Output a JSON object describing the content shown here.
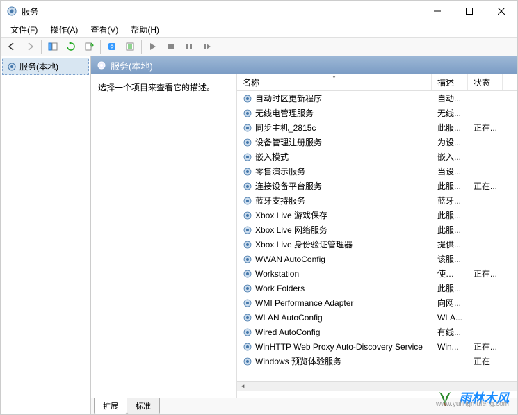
{
  "window": {
    "title": "服务"
  },
  "menu": {
    "file": "文件(F)",
    "action": "操作(A)",
    "view": "查看(V)",
    "help": "帮助(H)"
  },
  "sidebar": {
    "item": "服务(本地)"
  },
  "mainHeader": "服务(本地)",
  "descPanel": "选择一个项目来查看它的描述。",
  "columns": {
    "name": "名称",
    "desc": "描述",
    "status": "状态"
  },
  "tabs": {
    "extended": "扩展",
    "standard": "标准"
  },
  "services": [
    {
      "name": "自动时区更新程序",
      "desc": "自动...",
      "status": ""
    },
    {
      "name": "无线电管理服务",
      "desc": "无线...",
      "status": ""
    },
    {
      "name": "同步主机_2815c",
      "desc": "此服...",
      "status": "正在..."
    },
    {
      "name": "设备管理注册服务",
      "desc": "为设...",
      "status": ""
    },
    {
      "name": "嵌入模式",
      "desc": "嵌入...",
      "status": ""
    },
    {
      "name": "零售演示服务",
      "desc": "当设...",
      "status": ""
    },
    {
      "name": "连接设备平台服务",
      "desc": "此服...",
      "status": "正在..."
    },
    {
      "name": "蓝牙支持服务",
      "desc": "蓝牙...",
      "status": ""
    },
    {
      "name": "Xbox Live 游戏保存",
      "desc": "此服...",
      "status": ""
    },
    {
      "name": "Xbox Live 网络服务",
      "desc": "此服...",
      "status": ""
    },
    {
      "name": "Xbox Live 身份验证管理器",
      "desc": "提供...",
      "status": ""
    },
    {
      "name": "WWAN AutoConfig",
      "desc": "该服...",
      "status": ""
    },
    {
      "name": "Workstation",
      "desc": "使用 ...",
      "status": "正在..."
    },
    {
      "name": "Work Folders",
      "desc": "此服...",
      "status": ""
    },
    {
      "name": "WMI Performance Adapter",
      "desc": "向网...",
      "status": ""
    },
    {
      "name": "WLAN AutoConfig",
      "desc": "WLA...",
      "status": ""
    },
    {
      "name": "Wired AutoConfig",
      "desc": "有线...",
      "status": ""
    },
    {
      "name": "WinHTTP Web Proxy Auto-Discovery Service",
      "desc": "Win...",
      "status": "正在..."
    },
    {
      "name": "Windows 预览体验服务",
      "desc": "",
      "status": "正在"
    }
  ],
  "watermark": {
    "text": "雨林木风",
    "url": "www.yulingmufeng.com"
  }
}
